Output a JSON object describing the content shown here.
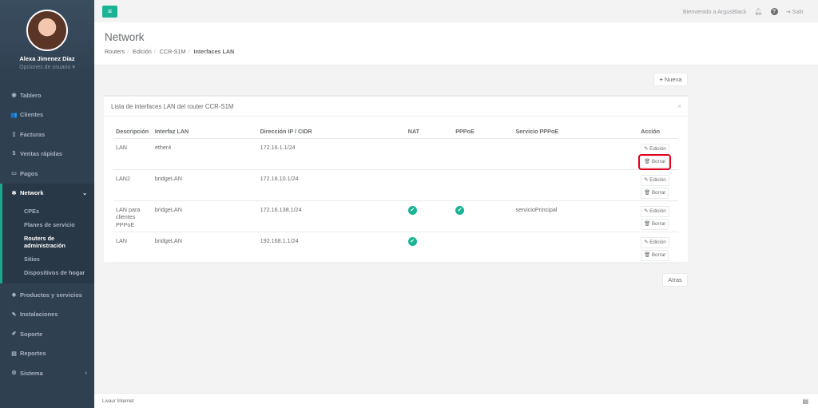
{
  "sidebar": {
    "user_name": "Alexa Jimenez Diaz",
    "user_options": "Opciones de usuario",
    "items": [
      {
        "label": "Tablero",
        "icon": "dashboard-icon"
      },
      {
        "label": "Clientes",
        "icon": "users-icon"
      },
      {
        "label": "Facturas",
        "icon": "file-icon"
      },
      {
        "label": "Ventas rápidas",
        "icon": "dollar-icon"
      },
      {
        "label": "Pagos",
        "icon": "money-icon"
      },
      {
        "label": "Network",
        "icon": "network-icon"
      }
    ],
    "network_sub": [
      "CPEs",
      "Planes de servicio",
      "Routers de administración",
      "Sitios",
      "Dispositivos de hogar"
    ],
    "items_after": [
      {
        "label": "Productos y servicios",
        "icon": "tag-icon"
      },
      {
        "label": "Instalaciones",
        "icon": "wrench-icon"
      },
      {
        "label": "Soporte",
        "icon": "support-icon"
      },
      {
        "label": "Reportes",
        "icon": "chart-icon"
      },
      {
        "label": "Sistema",
        "icon": "cogs-icon"
      }
    ]
  },
  "topbar": {
    "welcome": "Bienvenido a ArgusBlack",
    "logout": "Salir"
  },
  "heading": {
    "title": "Network",
    "breadcrumb": [
      "Routers",
      "Edición",
      "CCR-S1M",
      "Interfaces LAN"
    ]
  },
  "actions": {
    "new_label": "Nueva",
    "back_label": "Atras"
  },
  "panel": {
    "title": "Lista de interfaces LAN del router CCR-S1M",
    "columns": [
      "Descripción",
      "Interfaz LAN",
      "Dirección IP / CIDR",
      "NAT",
      "PPPoE",
      "Servicio PPPoE",
      "Acción"
    ],
    "rows": [
      {
        "desc": "LAN",
        "iface": "ether4",
        "ip": "172.16.1.1/24",
        "nat": false,
        "pppoe": false,
        "service": ""
      },
      {
        "desc": "LAN2",
        "iface": "bridgeLAN",
        "ip": "172.16.10.1/24",
        "nat": false,
        "pppoe": false,
        "service": ""
      },
      {
        "desc": "LAN para clientes PPPoE",
        "iface": "bridgeLAN",
        "ip": "172.16.138.1/24",
        "nat": true,
        "pppoe": true,
        "service": "servicioPrincipal"
      },
      {
        "desc": "LAN",
        "iface": "bridgeLAN",
        "ip": "192.168.1.1/24",
        "nat": true,
        "pppoe": false,
        "service": ""
      }
    ],
    "edit_label": "Edición",
    "delete_label": "Borrar"
  },
  "footer": {
    "company": "Livaur Internet"
  },
  "colors": {
    "sidebar": "#2f4050",
    "accent": "#1ab394",
    "highlight": "#e0001b"
  }
}
